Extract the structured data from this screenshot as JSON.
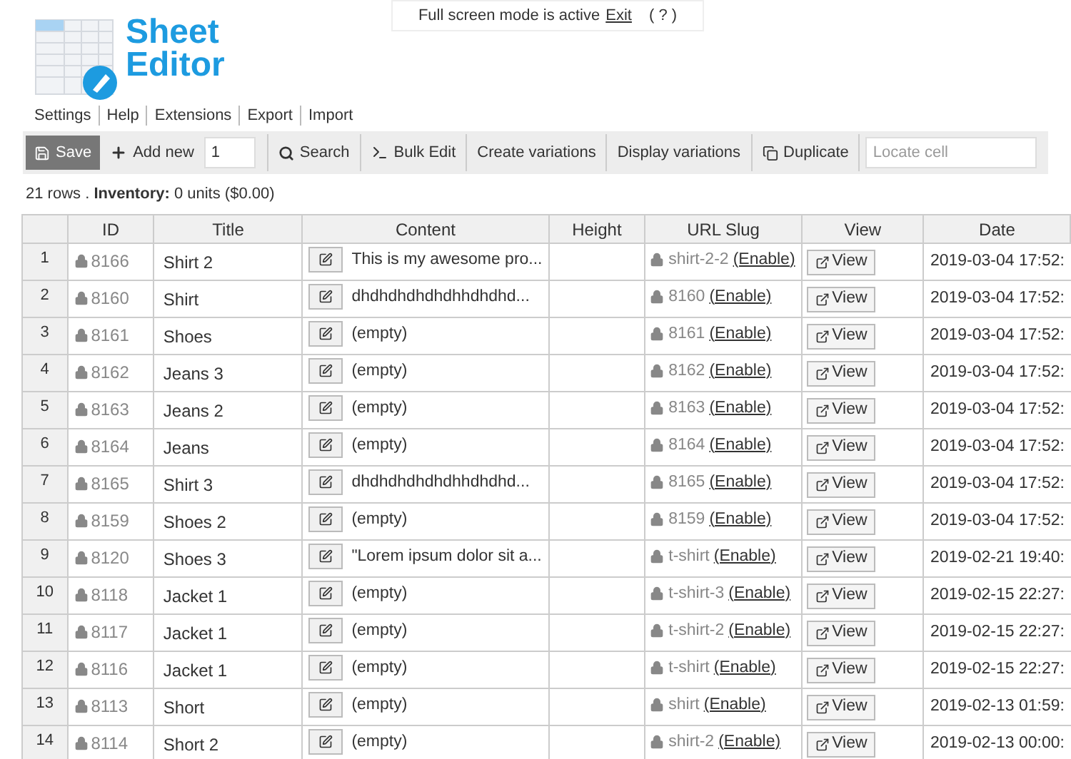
{
  "banner": {
    "text": "Full screen mode is active",
    "exit_link": "Exit",
    "help_link": "( ? )"
  },
  "logo": {
    "line_1": "Sheet",
    "line_2": "Editor"
  },
  "menu": [
    "Settings",
    "Help",
    "Extensions",
    "Export",
    "Import"
  ],
  "toolbar": {
    "save": "Save",
    "add_new": "Add new",
    "add_count": "1",
    "search": "Search",
    "bulk_edit": "Bulk Edit",
    "create_variations": "Create variations",
    "display_variations": "Display variations",
    "duplicate": "Duplicate",
    "locate_placeholder": "Locate cell"
  },
  "summary": {
    "rows": "21 rows .",
    "inventory_label": "Inventory:",
    "inventory_value": "0 units ($0.00)"
  },
  "table": {
    "columns": [
      "ID",
      "Title",
      "Content",
      "Height",
      "URL Slug",
      "View",
      "Date"
    ],
    "rows": [
      {
        "row": "1",
        "id": "8166",
        "title": "Shirt 2",
        "content": "This is my awesome pro...",
        "url_slug": "shirt-2-2",
        "enable": "(Enable)",
        "view": "View",
        "date": "2019-03-04 17:52:"
      },
      {
        "row": "2",
        "id": "8160",
        "title": "Shirt",
        "content": "dhdhdhdhdhdhhdhdhd...",
        "url_slug": "8160",
        "enable": "(Enable)",
        "view": "View",
        "date": "2019-03-04 17:52:"
      },
      {
        "row": "3",
        "id": "8161",
        "title": "Shoes",
        "content": "(empty)",
        "url_slug": "8161",
        "enable": "(Enable)",
        "view": "View",
        "date": "2019-03-04 17:52:"
      },
      {
        "row": "4",
        "id": "8162",
        "title": "Jeans 3",
        "content": "(empty)",
        "url_slug": "8162",
        "enable": "(Enable)",
        "view": "View",
        "date": "2019-03-04 17:52:"
      },
      {
        "row": "5",
        "id": "8163",
        "title": "Jeans 2",
        "content": "(empty)",
        "url_slug": "8163",
        "enable": "(Enable)",
        "view": "View",
        "date": "2019-03-04 17:52:"
      },
      {
        "row": "6",
        "id": "8164",
        "title": "Jeans",
        "content": "(empty)",
        "url_slug": "8164",
        "enable": "(Enable)",
        "view": "View",
        "date": "2019-03-04 17:52:"
      },
      {
        "row": "7",
        "id": "8165",
        "title": "Shirt 3",
        "content": "dhdhdhdhdhdhhdhdhd...",
        "url_slug": "8165",
        "enable": "(Enable)",
        "view": "View",
        "date": "2019-03-04 17:52:"
      },
      {
        "row": "8",
        "id": "8159",
        "title": "Shoes 2",
        "content": "(empty)",
        "url_slug": "8159",
        "enable": "(Enable)",
        "view": "View",
        "date": "2019-03-04 17:52:"
      },
      {
        "row": "9",
        "id": "8120",
        "title": "Shoes 3",
        "content": "\"Lorem ipsum dolor sit a...",
        "url_slug": "t-shirt",
        "enable": "(Enable)",
        "view": "View",
        "date": "2019-02-21 19:40:"
      },
      {
        "row": "10",
        "id": "8118",
        "title": "Jacket 1",
        "content": "(empty)",
        "url_slug": "t-shirt-3",
        "enable": "(Enable)",
        "view": "View",
        "date": "2019-02-15 22:27:"
      },
      {
        "row": "11",
        "id": "8117",
        "title": "Jacket 1",
        "content": "(empty)",
        "url_slug": "t-shirt-2",
        "enable": "(Enable)",
        "view": "View",
        "date": "2019-02-15 22:27:"
      },
      {
        "row": "12",
        "id": "8116",
        "title": "Jacket 1",
        "content": "(empty)",
        "url_slug": "t-shirt",
        "enable": "(Enable)",
        "view": "View",
        "date": "2019-02-15 22:27:"
      },
      {
        "row": "13",
        "id": "8113",
        "title": "Short",
        "content": "(empty)",
        "url_slug": "shirt",
        "enable": "(Enable)",
        "view": "View",
        "date": "2019-02-13 01:59:"
      },
      {
        "row": "14",
        "id": "8114",
        "title": "Short 2",
        "content": "(empty)",
        "url_slug": "shirt-2",
        "enable": "(Enable)",
        "view": "View",
        "date": "2019-02-13 00:00:"
      }
    ]
  }
}
